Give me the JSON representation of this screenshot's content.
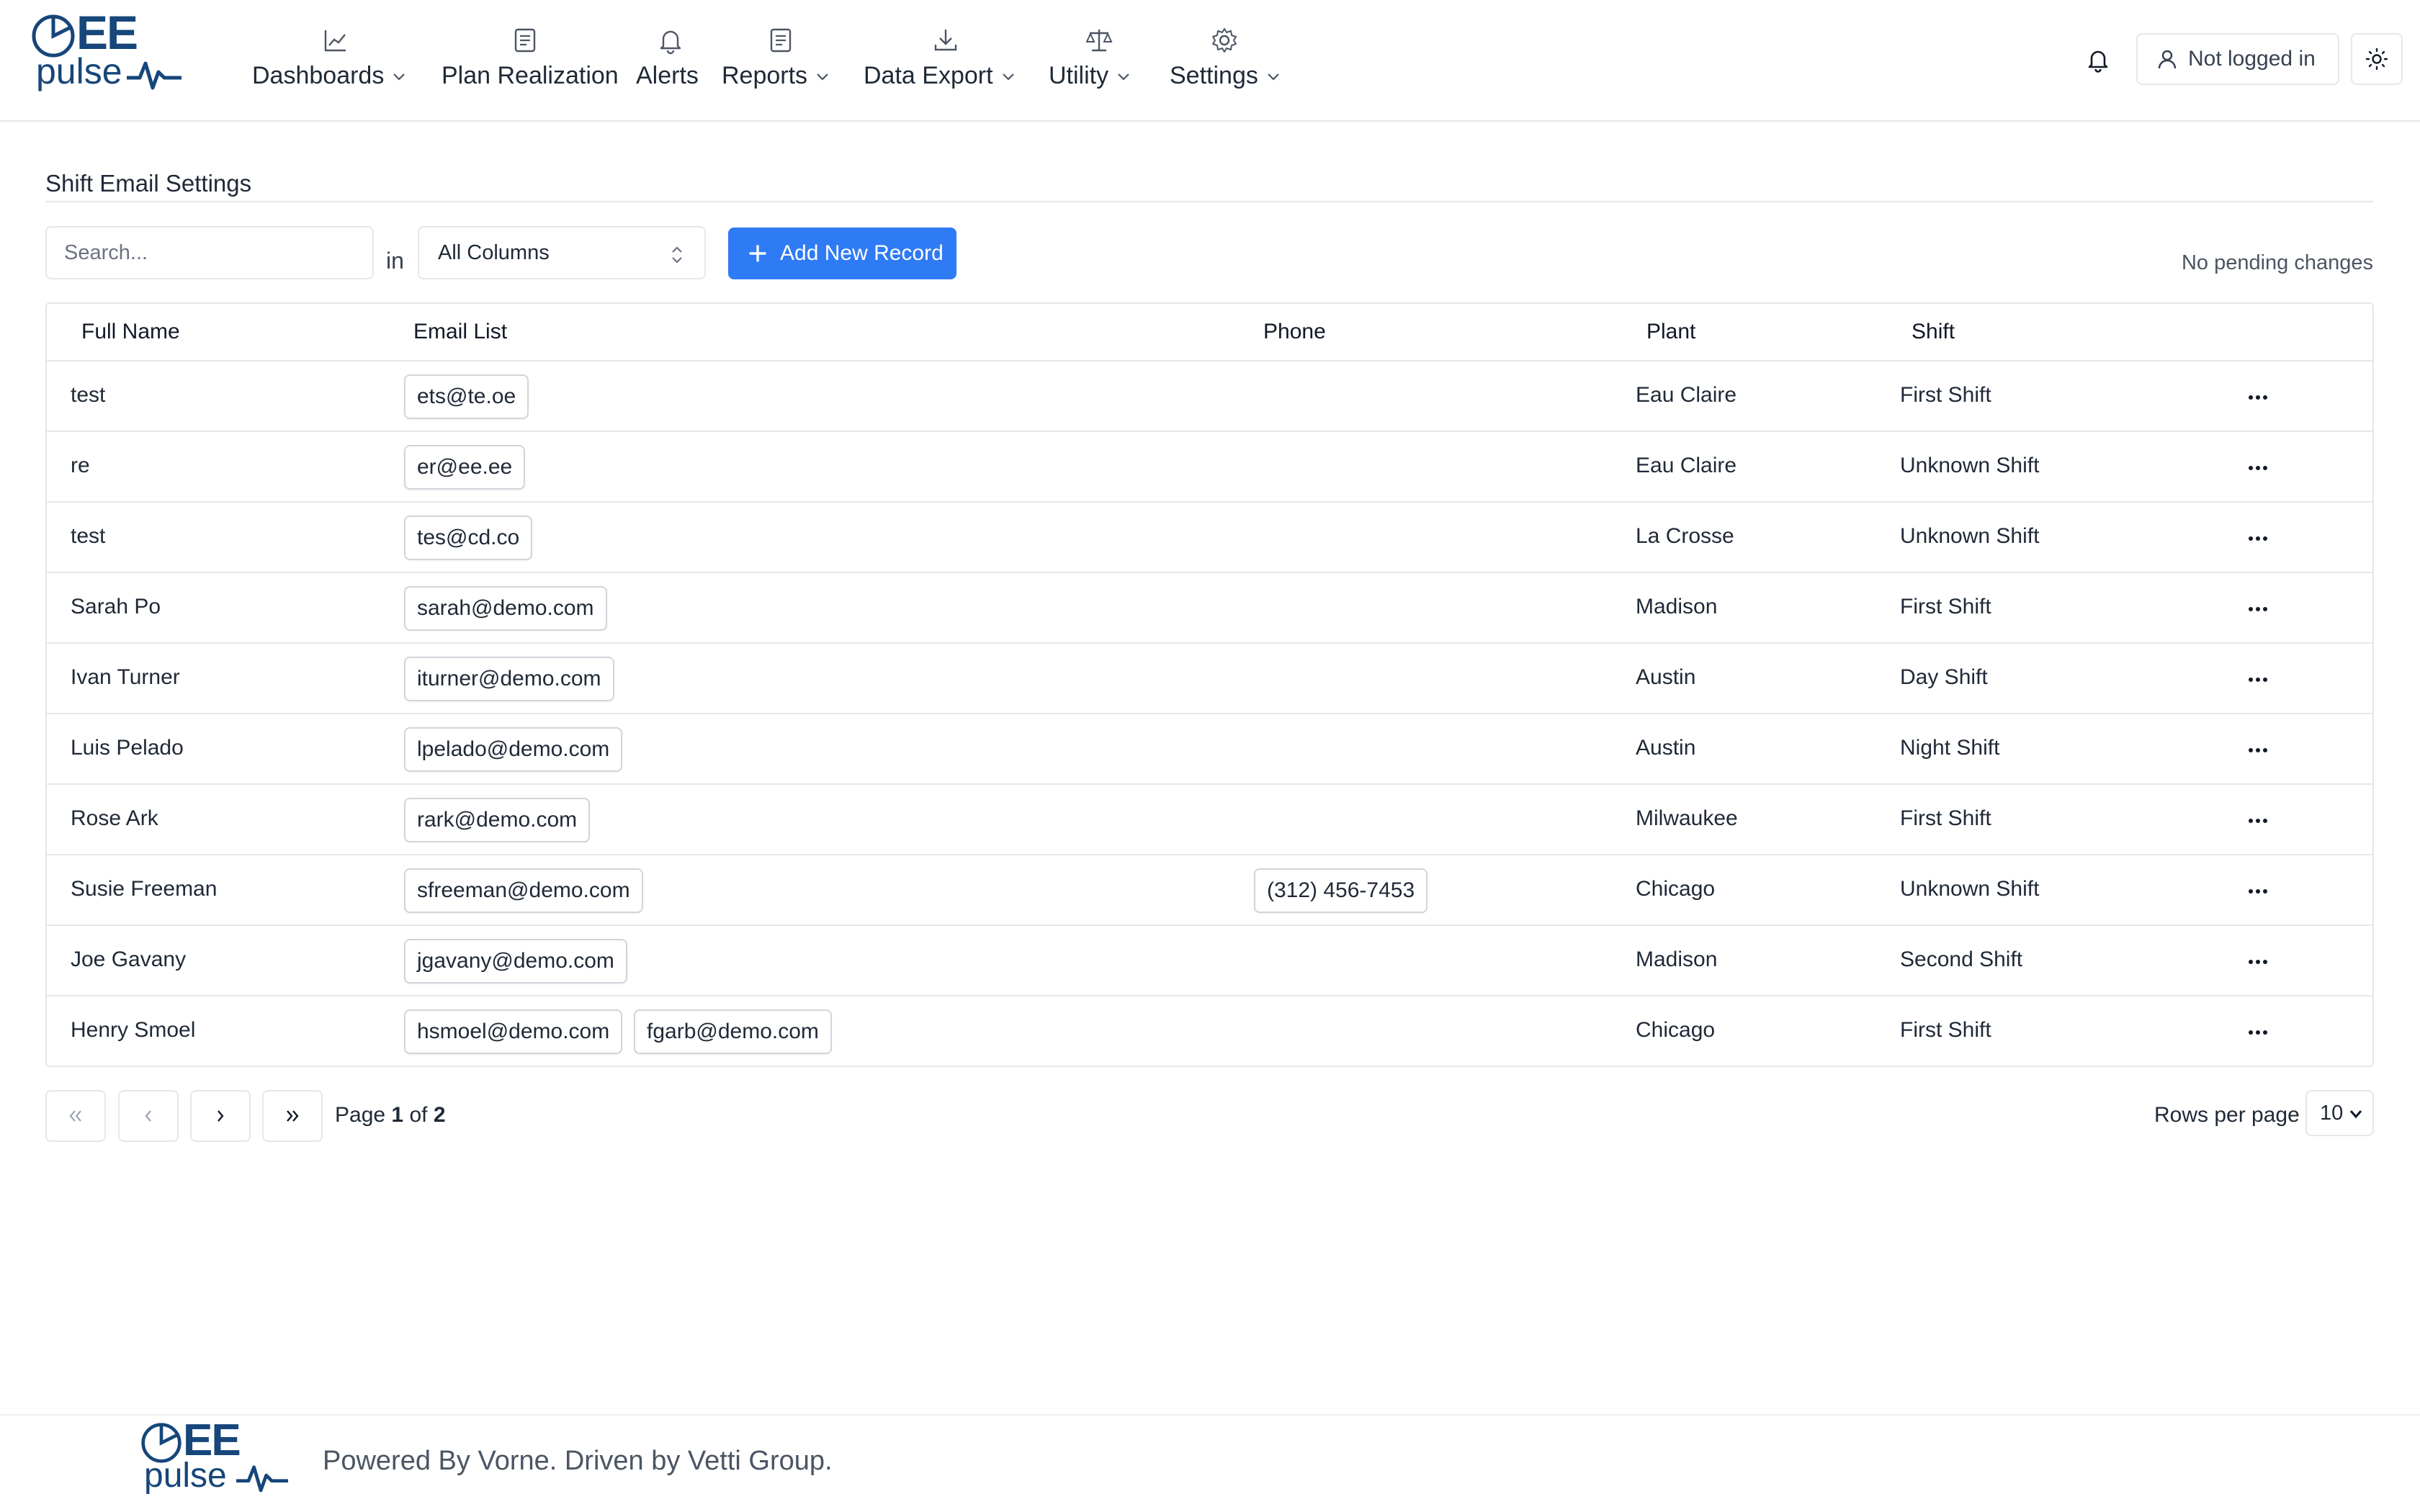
{
  "brand": {
    "logo_top": "EE",
    "logo_bottom": "pulse",
    "primary_color": "#16467a",
    "accent_color": "#2f7bf5"
  },
  "nav": {
    "items": [
      {
        "label": "Dashboards",
        "icon": "chart-line-icon",
        "has_dropdown": true
      },
      {
        "label": "Plan Realization",
        "icon": "document-icon",
        "has_dropdown": false
      },
      {
        "label": "Alerts",
        "icon": "bell-icon",
        "has_dropdown": false
      },
      {
        "label": "Reports",
        "icon": "report-icon",
        "has_dropdown": true
      },
      {
        "label": "Data Export",
        "icon": "download-icon",
        "has_dropdown": true
      },
      {
        "label": "Utility",
        "icon": "scale-icon",
        "has_dropdown": true
      },
      {
        "label": "Settings",
        "icon": "gear-icon",
        "has_dropdown": true
      }
    ]
  },
  "header": {
    "login_label": "Not logged in"
  },
  "page": {
    "title": "Shift Email Settings"
  },
  "toolbar": {
    "search_placeholder": "Search...",
    "in_label": "in",
    "column_select_value": "All Columns",
    "add_button_label": "Add New Record",
    "status_text": "No pending changes"
  },
  "table": {
    "columns": [
      "Full Name",
      "Email List",
      "Phone",
      "Plant",
      "Shift"
    ],
    "rows": [
      {
        "name": "test",
        "emails": [
          "ets@te.oe"
        ],
        "phone": "",
        "plant": "Eau Claire",
        "shift": "First Shift"
      },
      {
        "name": "re",
        "emails": [
          "er@ee.ee"
        ],
        "phone": "",
        "plant": "Eau Claire",
        "shift": "Unknown Shift"
      },
      {
        "name": "test",
        "emails": [
          "tes@cd.co"
        ],
        "phone": "",
        "plant": "La Crosse",
        "shift": "Unknown Shift"
      },
      {
        "name": "Sarah Po",
        "emails": [
          "sarah@demo.com"
        ],
        "phone": "",
        "plant": "Madison",
        "shift": "First Shift"
      },
      {
        "name": "Ivan Turner",
        "emails": [
          "iturner@demo.com"
        ],
        "phone": "",
        "plant": "Austin",
        "shift": "Day Shift"
      },
      {
        "name": "Luis Pelado",
        "emails": [
          "lpelado@demo.com"
        ],
        "phone": "",
        "plant": "Austin",
        "shift": "Night Shift"
      },
      {
        "name": "Rose Ark",
        "emails": [
          "rark@demo.com"
        ],
        "phone": "",
        "plant": "Milwaukee",
        "shift": "First Shift"
      },
      {
        "name": "Susie Freeman",
        "emails": [
          "sfreeman@demo.com"
        ],
        "phone": "(312) 456-7453",
        "plant": "Chicago",
        "shift": "Unknown Shift"
      },
      {
        "name": "Joe Gavany",
        "emails": [
          "jgavany@demo.com"
        ],
        "phone": "",
        "plant": "Madison",
        "shift": "Second Shift"
      },
      {
        "name": "Henry Smoel",
        "emails": [
          "hsmoel@demo.com",
          "fgarb@demo.com"
        ],
        "phone": "",
        "plant": "Chicago",
        "shift": "First Shift"
      }
    ]
  },
  "pagination": {
    "page_prefix": "Page",
    "current_page": "1",
    "of_label": "of",
    "total_pages": "2",
    "rows_per_page_label": "Rows per page",
    "rows_per_page_value": "10"
  },
  "footer": {
    "text": "Powered By Vorne. Driven by Vetti Group."
  }
}
